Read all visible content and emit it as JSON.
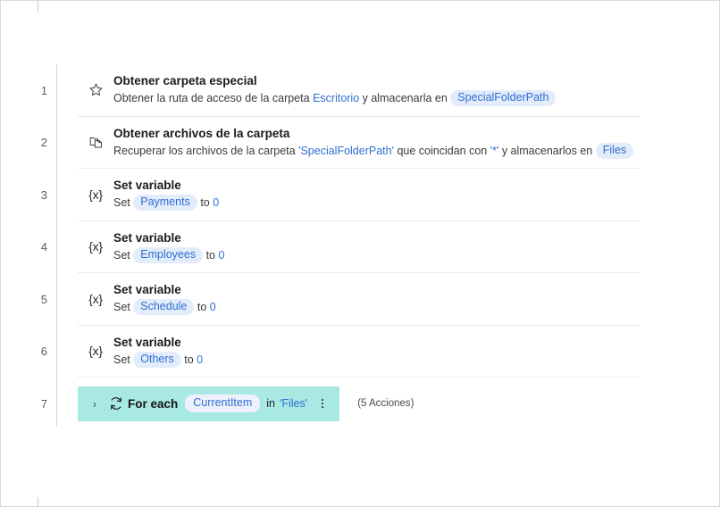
{
  "flow": {
    "steps": [
      {
        "index": "1",
        "icon": "star-icon",
        "title": "Obtener carpeta especial",
        "desc_parts": [
          {
            "t": "Obtener la ruta de acceso de la carpeta ",
            "k": "plain"
          },
          {
            "t": "Escritorio",
            "k": "link"
          },
          {
            "t": " y almacenarla en ",
            "k": "plain"
          },
          {
            "t": "SpecialFolderPath",
            "k": "pill"
          }
        ]
      },
      {
        "index": "2",
        "icon": "folder-files-icon",
        "title": "Obtener archivos de la carpeta",
        "desc_parts": [
          {
            "t": "Recuperar los archivos de la carpeta ",
            "k": "plain"
          },
          {
            "t": "'SpecialFolderPath'",
            "k": "link"
          },
          {
            "t": " que coincidan con ",
            "k": "plain"
          },
          {
            "t": "'*'",
            "k": "link"
          },
          {
            "t": " y almacenarlos en ",
            "k": "plain"
          },
          {
            "t": "Files",
            "k": "pill"
          }
        ]
      },
      {
        "index": "3",
        "icon": "variable-icon",
        "icon_text": "{x}",
        "title": "Set variable",
        "desc_parts": [
          {
            "t": "Set ",
            "k": "plain"
          },
          {
            "t": "Payments",
            "k": "pill"
          },
          {
            "t": " to ",
            "k": "plain"
          },
          {
            "t": "0",
            "k": "num"
          }
        ]
      },
      {
        "index": "4",
        "icon": "variable-icon",
        "icon_text": "{x}",
        "title": "Set variable",
        "desc_parts": [
          {
            "t": "Set ",
            "k": "plain"
          },
          {
            "t": "Employees",
            "k": "pill"
          },
          {
            "t": " to ",
            "k": "plain"
          },
          {
            "t": "0",
            "k": "num"
          }
        ]
      },
      {
        "index": "5",
        "icon": "variable-icon",
        "icon_text": "{x}",
        "title": "Set variable",
        "desc_parts": [
          {
            "t": "Set ",
            "k": "plain"
          },
          {
            "t": "Schedule",
            "k": "pill"
          },
          {
            "t": " to ",
            "k": "plain"
          },
          {
            "t": "0",
            "k": "num"
          }
        ]
      },
      {
        "index": "6",
        "icon": "variable-icon",
        "icon_text": "{x}",
        "title": "Set variable",
        "desc_parts": [
          {
            "t": "Set ",
            "k": "plain"
          },
          {
            "t": "Others",
            "k": "pill"
          },
          {
            "t": " to ",
            "k": "plain"
          },
          {
            "t": "0",
            "k": "num"
          }
        ]
      }
    ],
    "loop_step": {
      "index": "7",
      "caret": "›",
      "icon": "loop-refresh-icon",
      "label": "For each",
      "variable": "CurrentItem",
      "in_word": "in",
      "source": "'Files'",
      "menu": "more-options-icon",
      "count_label": "(5 Acciones)",
      "highlight_color": "#a8e9e3"
    }
  },
  "colors": {
    "accent_link": "#2f6fd0",
    "pill_bg": "#e3ecfb",
    "loop_highlight": "#a8e9e3",
    "row_separator": "#eaeaea"
  }
}
